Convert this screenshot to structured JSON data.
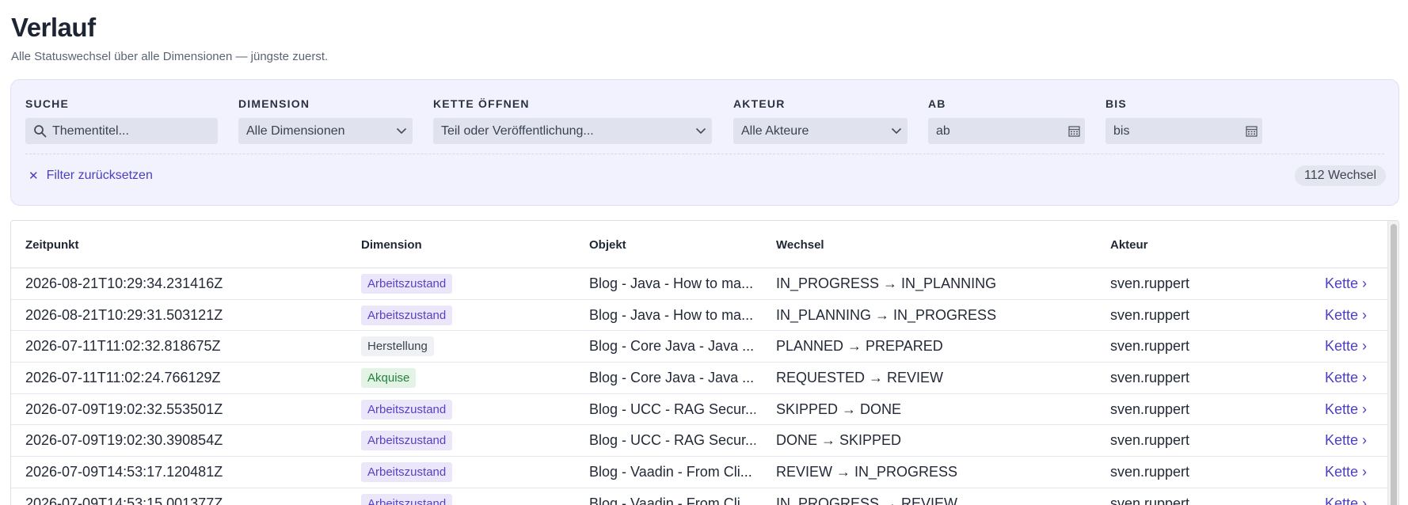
{
  "header": {
    "title": "Verlauf",
    "subtitle": "Alle Statuswechsel über alle Dimensionen — jüngste zuerst."
  },
  "filters": {
    "search": {
      "label": "SUCHE",
      "placeholder": "Thementitel..."
    },
    "dimension": {
      "label": "DIMENSION",
      "value": "Alle Dimensionen"
    },
    "chain": {
      "label": "KETTE ÖFFNEN",
      "value": "Teil oder Veröffentlichung..."
    },
    "actor": {
      "label": "AKTEUR",
      "value": "Alle Akteure"
    },
    "from": {
      "label": "AB",
      "placeholder": "ab"
    },
    "to": {
      "label": "BIS",
      "placeholder": "bis"
    },
    "reset_label": "Filter zurücksetzen",
    "count_label": "112 Wechsel"
  },
  "table": {
    "columns": {
      "time": "Zeitpunkt",
      "dimension": "Dimension",
      "object": "Objekt",
      "change": "Wechsel",
      "actor": "Akteur"
    },
    "rows": [
      {
        "time": "2026-08-21T10:29:34.231416Z",
        "dimension": "Arbeitszustand",
        "dim_type": "arbeitszustand",
        "object": "Blog - Java - How to ma...",
        "change": "IN_PROGRESS → IN_PLANNING",
        "actor": "sven.ruppert",
        "link": "Kette ›"
      },
      {
        "time": "2026-08-21T10:29:31.503121Z",
        "dimension": "Arbeitszustand",
        "dim_type": "arbeitszustand",
        "object": "Blog - Java - How to ma...",
        "change": "IN_PLANNING → IN_PROGRESS",
        "actor": "sven.ruppert",
        "link": "Kette ›"
      },
      {
        "time": "2026-07-11T11:02:32.818675Z",
        "dimension": "Herstellung",
        "dim_type": "herstellung",
        "object": "Blog - Core Java - Java ...",
        "change": "PLANNED → PREPARED",
        "actor": "sven.ruppert",
        "link": "Kette ›"
      },
      {
        "time": "2026-07-11T11:02:24.766129Z",
        "dimension": "Akquise",
        "dim_type": "akquise",
        "object": "Blog - Core Java - Java ...",
        "change": "REQUESTED → REVIEW",
        "actor": "sven.ruppert",
        "link": "Kette ›"
      },
      {
        "time": "2026-07-09T19:02:32.553501Z",
        "dimension": "Arbeitszustand",
        "dim_type": "arbeitszustand",
        "object": "Blog - UCC - RAG Secur...",
        "change": "SKIPPED → DONE",
        "actor": "sven.ruppert",
        "link": "Kette ›"
      },
      {
        "time": "2026-07-09T19:02:30.390854Z",
        "dimension": "Arbeitszustand",
        "dim_type": "arbeitszustand",
        "object": "Blog - UCC - RAG Secur...",
        "change": "DONE → SKIPPED",
        "actor": "sven.ruppert",
        "link": "Kette ›"
      },
      {
        "time": "2026-07-09T14:53:17.120481Z",
        "dimension": "Arbeitszustand",
        "dim_type": "arbeitszustand",
        "object": "Blog - Vaadin - From Cli...",
        "change": "REVIEW → IN_PROGRESS",
        "actor": "sven.ruppert",
        "link": "Kette ›"
      },
      {
        "time": "2026-07-09T14:53:15.001377Z",
        "dimension": "Arbeitszustand",
        "dim_type": "arbeitszustand",
        "object": "Blog - Vaadin - From Cli...",
        "change": "IN_PROGRESS → REVIEW",
        "actor": "sven.ruppert",
        "link": "Kette ›"
      }
    ]
  },
  "colors": {
    "accent": "#4c3fc2",
    "panel_bg": "#f1f2fd",
    "badge_arbeitszustand": "#ebe6fa",
    "badge_akquise": "#e3f4e6",
    "badge_herstellung": "#f0f1f4"
  },
  "icons": {
    "search": "search-icon",
    "chevron": "chevron-down-icon",
    "calendar": "calendar-icon",
    "reset": "close-icon"
  }
}
